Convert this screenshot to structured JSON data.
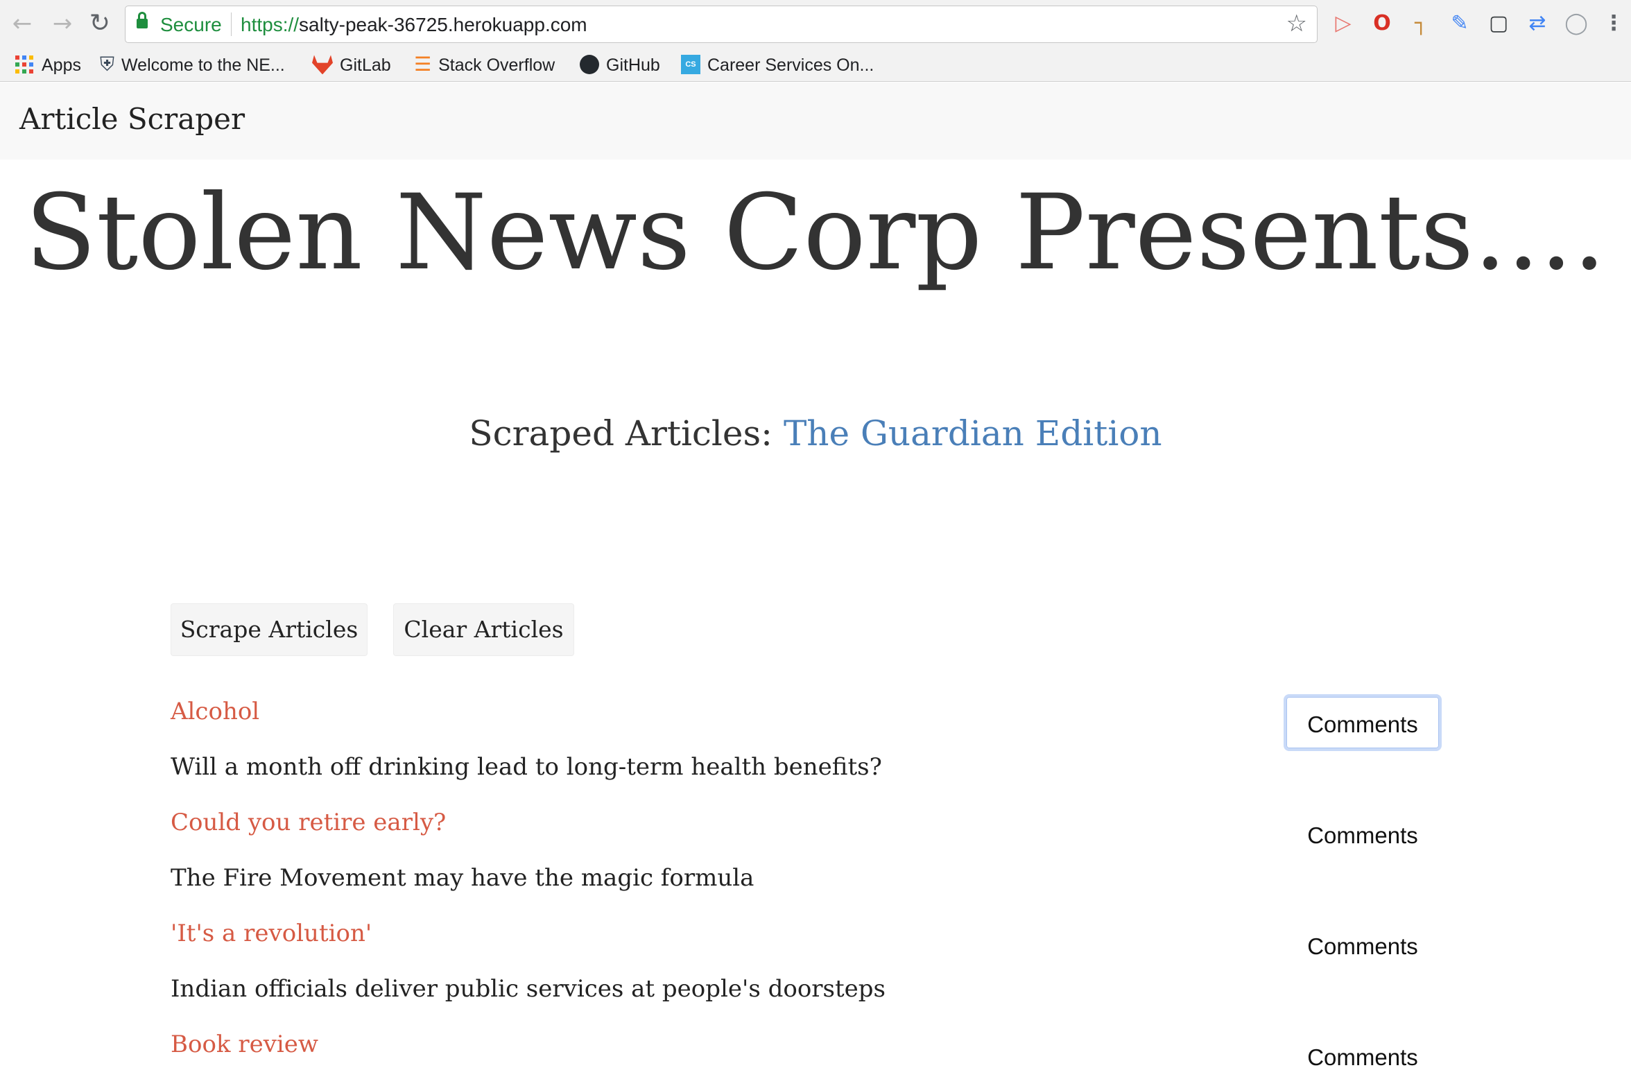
{
  "browser": {
    "security_label": "Secure",
    "url_scheme": "https://",
    "url_host": "salty-peak-36725.herokuapp.com",
    "bookmarks": [
      {
        "label": "Apps",
        "icon": "apps-grid-icon"
      },
      {
        "label": "Welcome to the NE...",
        "icon": "shield-icon"
      },
      {
        "label": "GitLab",
        "icon": "gitlab-icon"
      },
      {
        "label": "Stack Overflow",
        "icon": "stackoverflow-icon"
      },
      {
        "label": "GitHub",
        "icon": "github-icon"
      },
      {
        "label": "Career Services On...",
        "icon": "career-services-icon"
      }
    ],
    "extension_icons": [
      "screencast-icon",
      "opera-icon",
      "ruler-icon",
      "color-picker-icon",
      "screenshot-icon",
      "swap-icon",
      "json-viewer-icon",
      "more-icon"
    ]
  },
  "navbar": {
    "brand": "Article Scraper"
  },
  "hero": {
    "title": "Stolen News Corp Presents....",
    "subtitle_prefix": "Scraped Articles:",
    "subtitle_link": "The Guardian Edition"
  },
  "actions": {
    "scrape_label": "Scrape Articles",
    "clear_label": "Clear Articles"
  },
  "articles": [
    {
      "headline": "Alcohol",
      "summary": "Will a month off drinking lead to long-term health benefits?",
      "comments_label": "Comments",
      "focused": true
    },
    {
      "headline": "Could you retire early?",
      "summary": "The Fire Movement may have the magic formula",
      "comments_label": "Comments",
      "focused": false
    },
    {
      "headline": "'It's a revolution'",
      "summary": "Indian officials deliver public services at people's doorsteps",
      "comments_label": "Comments",
      "focused": false
    },
    {
      "headline": "Book review",
      "summary": "",
      "comments_label": "Comments",
      "focused": false
    }
  ],
  "colors": {
    "headline": "#d65a44",
    "link": "#4a7fb8",
    "secure": "#1e8e3e",
    "focus_ring": "#c9daf8"
  }
}
